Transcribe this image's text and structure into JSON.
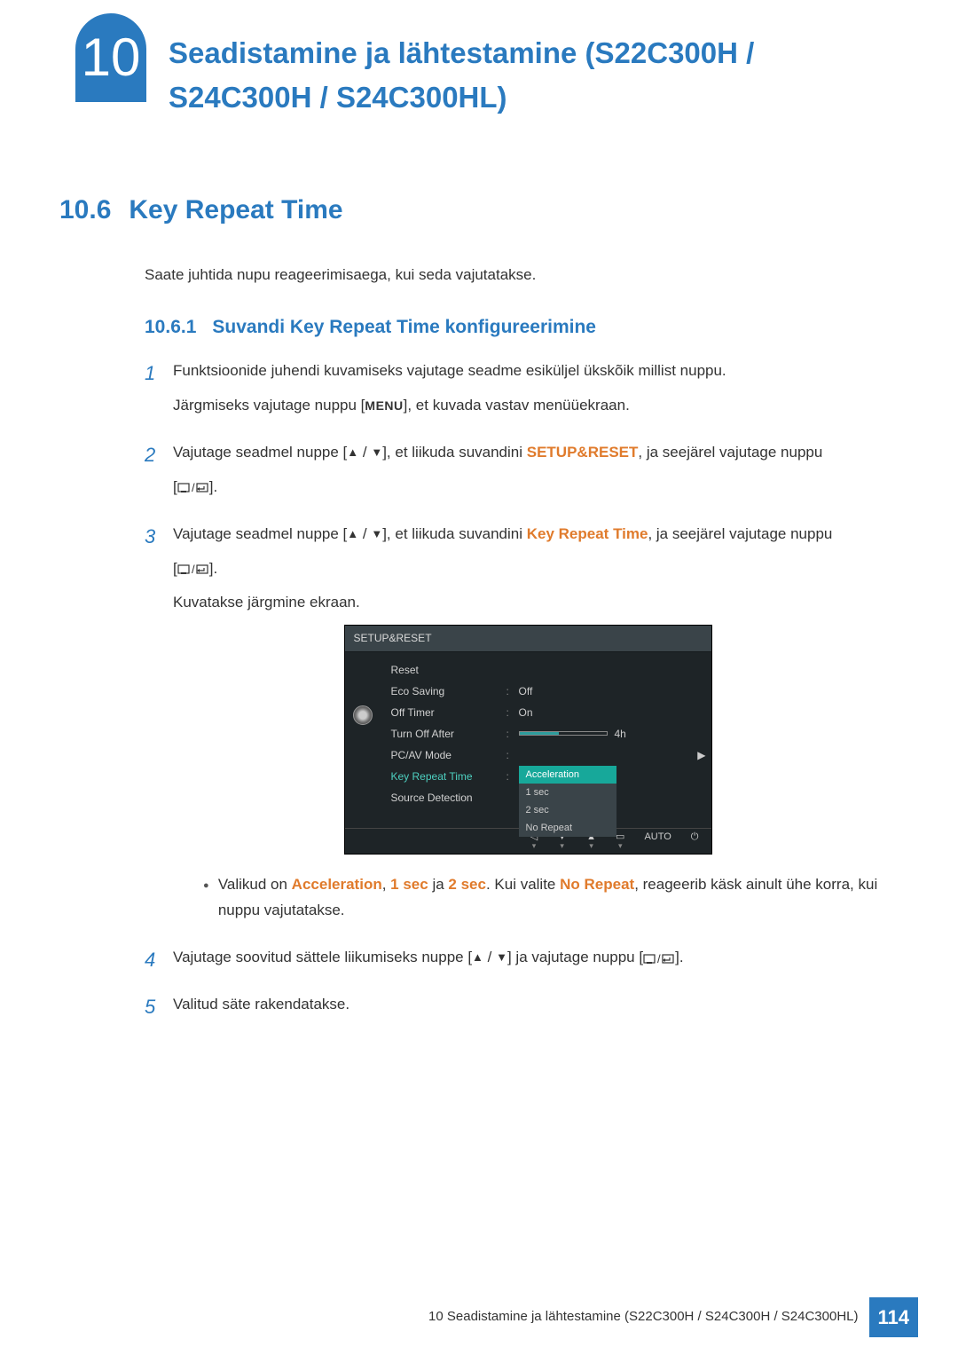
{
  "chapter": {
    "number": "10",
    "title": "Seadistamine ja lähtestamine (S22C300H / S24C300H / S24C300HL)"
  },
  "section": {
    "number": "10.6",
    "title": "Key Repeat Time",
    "intro": "Saate juhtida nupu reageerimisaega, kui seda vajutatakse."
  },
  "subsection": {
    "number": "10.6.1",
    "title": "Suvandi Key Repeat Time konfigureerimine"
  },
  "steps": {
    "s1": {
      "num": "1",
      "p1": "Funktsioonide juhendi kuvamiseks vajutage seadme esiküljel ükskõik millist nuppu.",
      "p2a": "Järgmiseks vajutage nuppu [",
      "menu": "MENU",
      "p2b": "], et kuvada vastav menüüekraan."
    },
    "s2": {
      "num": "2",
      "pa": "Vajutage seadmel nuppe [",
      "pb": "], et liikuda suvandini ",
      "hl": "SETUP&RESET",
      "pc": ", ja seejärel vajutage nuppu",
      "pd": "[",
      "pe": "]."
    },
    "s3": {
      "num": "3",
      "pa": "Vajutage seadmel nuppe [",
      "pb": "], et liikuda suvandini ",
      "hl": "Key Repeat Time",
      "pc": ", ja seejärel vajutage nuppu",
      "pd": "[",
      "pe": "].",
      "pf": "Kuvatakse järgmine ekraan."
    },
    "bullet": {
      "a": "Valikud on ",
      "o1": "Acceleration",
      "b": ", ",
      "o2": "1 sec",
      "c": " ja ",
      "o3": "2 sec",
      "d": ". Kui valite ",
      "o4": "No Repeat",
      "e": ", reageerib käsk ainult ühe korra, kui nuppu vajutatakse."
    },
    "s4": {
      "num": "4",
      "pa": "Vajutage soovitud sättele liikumiseks nuppe [",
      "pb": "] ja vajutage nuppu [",
      "pc": "]."
    },
    "s5": {
      "num": "5",
      "p": "Valitud säte rakendatakse."
    }
  },
  "osd": {
    "header": "SETUP&RESET",
    "items": {
      "reset": "Reset",
      "eco": "Eco Saving",
      "eco_val": "Off",
      "offtimer": "Off Timer",
      "offtimer_val": "On",
      "turnoff": "Turn Off After",
      "turnoff_val": "4h",
      "pcav": "PC/AV Mode",
      "krt": "Key Repeat Time",
      "srcdet": "Source Detection"
    },
    "dropdown": {
      "o1": "Acceleration",
      "o2": "1 sec",
      "o3": "2 sec",
      "o4": "No Repeat"
    },
    "footer": {
      "auto": "AUTO"
    }
  },
  "footer": {
    "text": "10 Seadistamine ja lähtestamine (S22C300H / S24C300H / S24C300HL)",
    "page": "114"
  }
}
